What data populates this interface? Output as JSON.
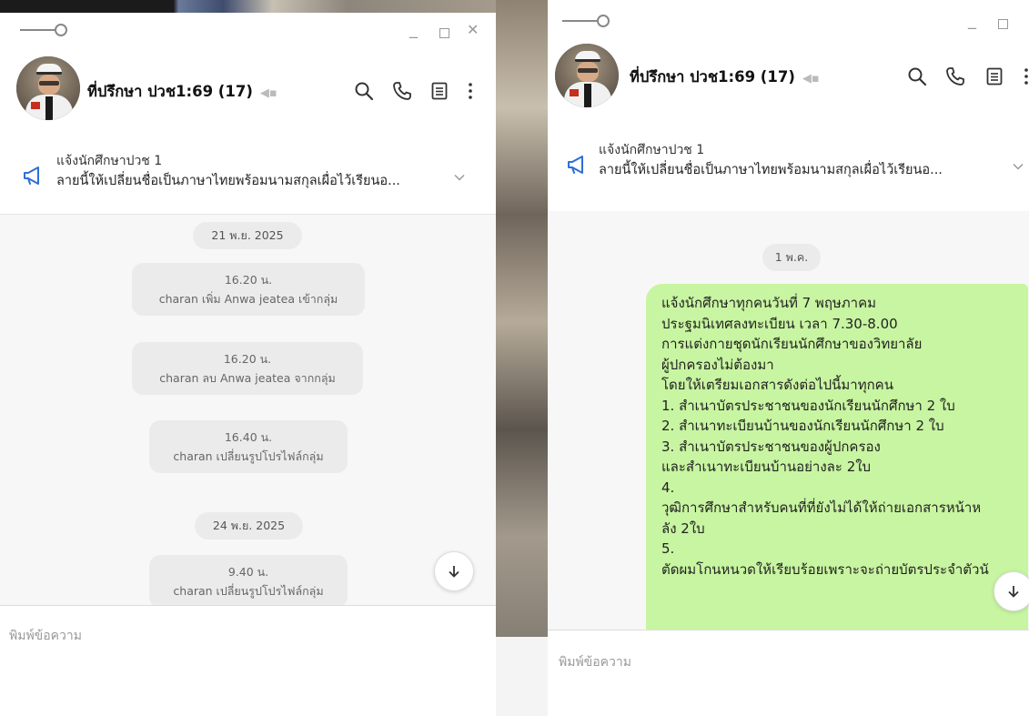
{
  "left_window": {
    "chat_title": "ที่ปรึกษา ปวช1:69 (17)",
    "notice": {
      "title": "แจ้งนักศึกษาปวช 1",
      "body": "ลายนี้ให้เปลี่ยนชื่อเป็นภาษาไทยพร้อมนามสกุลเผื่อไว้เรียนอ..."
    },
    "messages": [
      {
        "kind": "date",
        "text": "21 พ.ย. 2025"
      },
      {
        "kind": "system",
        "time": "16.20 น.",
        "text": "charan เพิ่ม Anwa jeatea เข้ากลุ่ม"
      },
      {
        "kind": "system",
        "time": "16.20 น.",
        "text": "charan ลบ Anwa jeatea จากกลุ่ม"
      },
      {
        "kind": "system",
        "time": "16.40 น.",
        "text": "charan เปลี่ยนรูปโปรไฟล์กลุ่ม"
      },
      {
        "kind": "date",
        "text": "24 พ.ย. 2025"
      },
      {
        "kind": "system",
        "time": "9.40 น.",
        "text": "charan เปลี่ยนรูปโปรไฟล์กลุ่ม"
      }
    ],
    "input_placeholder": "พิมพ์ข้อความ"
  },
  "right_window": {
    "chat_title": "ที่ปรึกษา ปวช1:69 (17)",
    "notice": {
      "title": "แจ้งนักศึกษาปวช 1",
      "body": "ลายนี้ให้เปลี่ยนชื่อเป็นภาษาไทยพร้อมนามสกุลเผื่อไว้เรียนอ..."
    },
    "date_pill": "1 พ.ค.",
    "bubble_lines": [
      "แจ้งนักศึกษาทุกคนวันที่ 7 พฤษภาคม",
      "ประฐมนิเทศลงทะเบียน เวลา 7.30-8.00",
      "การแต่งกายชุดนักเรียนนักศึกษาของวิทยาลัย",
      "ผู้ปกครองไม่ต้องมา",
      "โดยให้เตรียมเอกสารดังต่อไปนี้มาทุกคน",
      "1. สำเนาบัตรประชาชนของนักเรียนนักศึกษา 2 ใบ",
      "2. สำเนาทะเบียนบ้านของนักเรียนนักศึกษา 2 ใบ",
      "3. สำเนาบัตรประชาชนของผู้ปกครอง",
      "และสำเนาทะเบียนบ้านอย่างละ 2ใบ",
      "4.",
      "วุฒิการศึกษาสำหรับคนที่ที่ยังไม่ได้ให้ถ่ายเอกสารหน้าห",
      "ลัง 2ใบ",
      "5.",
      "ตัดผมโกนหนวดให้เรียบร้อยเพราะจะถ่ายบัตรประจำตัวนั"
    ],
    "input_placeholder": "พิมพ์ข้อความ"
  },
  "colors": {
    "bubble": "#c8f5a1",
    "chat_bg": "#f7f7f7",
    "pill": "#ebebeb",
    "megaphone": "#2f6fd4"
  },
  "icons": [
    "line-app-icon",
    "minimize-icon",
    "maximize-icon",
    "close-icon",
    "search-icon",
    "phone-icon",
    "notes-icon",
    "more-icon",
    "mute-icon",
    "megaphone-icon",
    "chevron-down-icon",
    "arrow-down-icon"
  ]
}
